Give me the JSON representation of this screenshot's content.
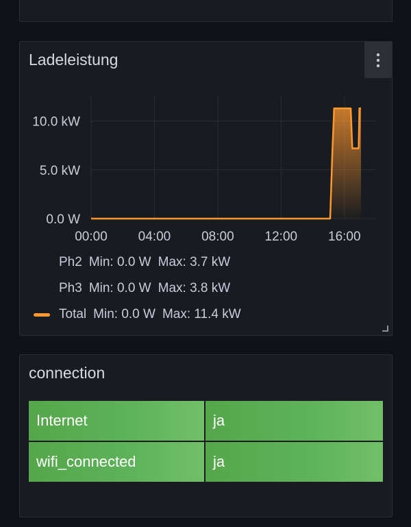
{
  "chart_panel": {
    "title": "Ladeleistung"
  },
  "chart_data": {
    "type": "line",
    "x_ticks": [
      "00:00",
      "04:00",
      "08:00",
      "12:00",
      "16:00"
    ],
    "y_ticks": [
      "0.0 W",
      "5.0 kW",
      "10.0 kW"
    ],
    "ylim": [
      0,
      12.5
    ],
    "xlim": [
      0,
      18
    ],
    "series": [
      {
        "name": "Total",
        "color": "#ff9830",
        "x": [
          0,
          15.1,
          15.25,
          15.35,
          15.6,
          16.4,
          16.5,
          16.55,
          16.9,
          16.95,
          17.05
        ],
        "y": [
          0,
          0,
          7.2,
          11.3,
          11.3,
          11.3,
          7.2,
          7.2,
          7.2,
          11.3,
          11.3
        ]
      }
    ],
    "legend": [
      {
        "name": "Ph2",
        "min": "Min: 0.0 W",
        "max": "Max: 3.7 kW",
        "show_swatch": false
      },
      {
        "name": "Ph3",
        "min": "Min: 0.0 W",
        "max": "Max: 3.8 kW",
        "show_swatch": false
      },
      {
        "name": "Total",
        "min": "Min: 0.0 W",
        "max": "Max: 11.4 kW",
        "show_swatch": true
      }
    ]
  },
  "connection_panel": {
    "title": "connection",
    "rows": [
      {
        "key": "Internet",
        "value": "ja"
      },
      {
        "key": "wifi_connected",
        "value": "ja"
      }
    ]
  }
}
